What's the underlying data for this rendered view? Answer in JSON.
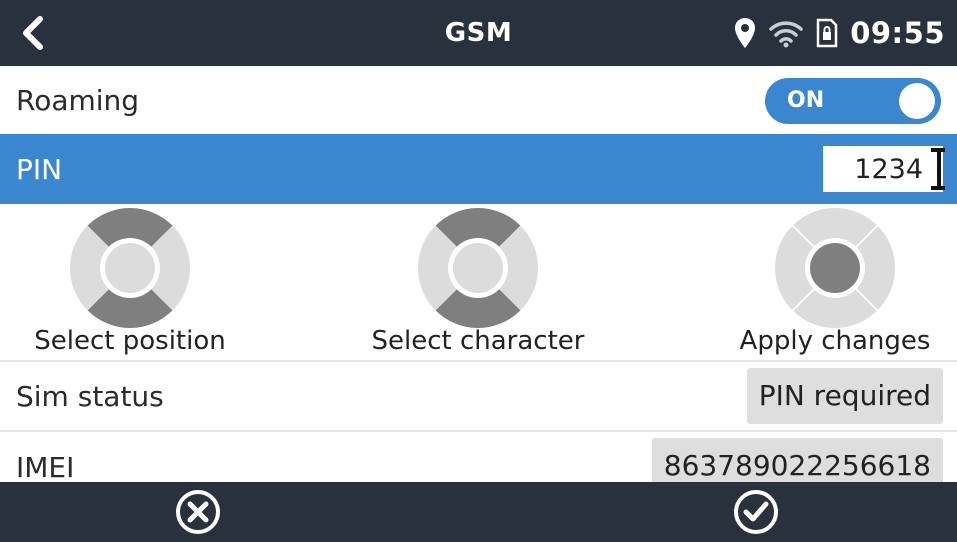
{
  "header": {
    "title": "GSM",
    "time": "09:55",
    "icons": [
      "back-chevron-icon",
      "location-pin-icon",
      "wifi-icon",
      "sim-lock-icon"
    ]
  },
  "roaming": {
    "label": "Roaming",
    "toggle_text": "ON",
    "state": true,
    "accent": "#3b87cf"
  },
  "pin": {
    "label": "PIN",
    "value": "1234"
  },
  "hints": [
    {
      "label": "Select position",
      "icon": "dpad-left-right-icon"
    },
    {
      "label": "Select character",
      "icon": "dpad-up-down-icon"
    },
    {
      "label": "Apply changes",
      "icon": "dpad-center-icon"
    }
  ],
  "sim_status": {
    "label": "Sim status",
    "value": "PIN required"
  },
  "imei": {
    "label": "IMEI",
    "value": "863789022256618"
  },
  "footer": {
    "icons": [
      "cancel-icon",
      "confirm-icon"
    ]
  },
  "colors": {
    "header_bg": "#28313c",
    "highlight": "#3b87cf",
    "value_bg": "#dedede"
  }
}
